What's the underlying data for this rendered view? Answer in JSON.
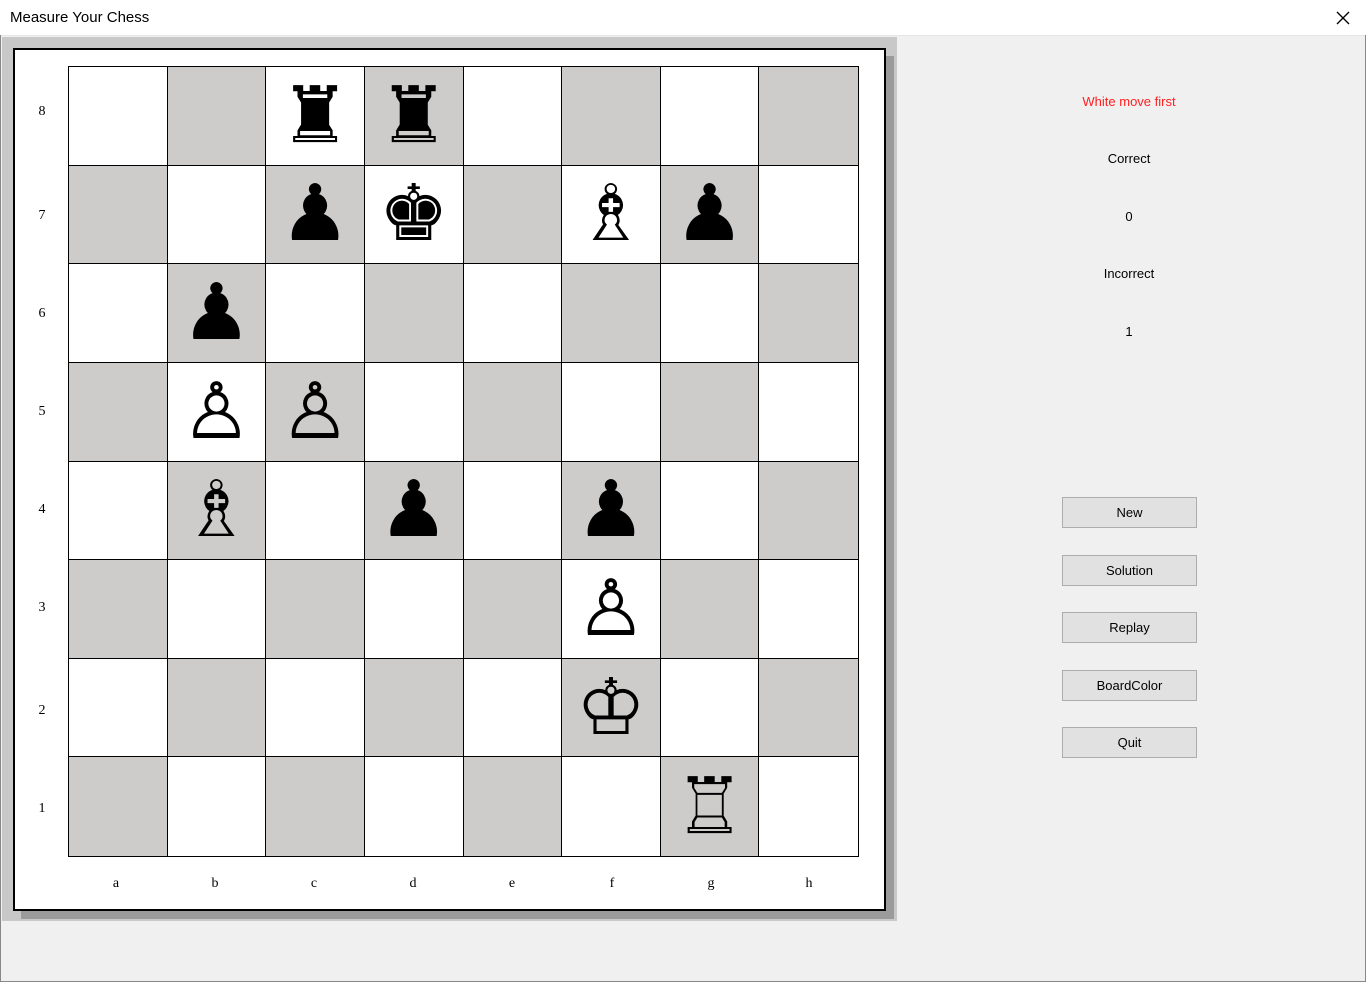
{
  "window": {
    "title": "Measure Your Chess"
  },
  "board": {
    "ranks": [
      "8",
      "7",
      "6",
      "5",
      "4",
      "3",
      "2",
      "1"
    ],
    "files": [
      "a",
      "b",
      "c",
      "d",
      "e",
      "f",
      "g",
      "h"
    ],
    "light_color": "#ffffff",
    "dark_color": "#cecbcb",
    "position": [
      [
        null,
        null,
        "♜",
        "♜",
        null,
        null,
        null,
        null
      ],
      [
        null,
        null,
        "♟",
        "♚",
        null,
        "♗",
        "♟",
        null
      ],
      [
        null,
        "♟",
        null,
        null,
        null,
        null,
        null,
        null
      ],
      [
        null,
        "♙",
        "♙",
        null,
        null,
        null,
        null,
        null
      ],
      [
        null,
        "♗",
        null,
        "♟",
        null,
        "♟",
        null,
        null
      ],
      [
        null,
        null,
        null,
        null,
        null,
        "♙",
        null,
        null
      ],
      [
        null,
        null,
        null,
        null,
        null,
        "♔",
        null,
        null
      ],
      [
        null,
        null,
        null,
        null,
        null,
        null,
        "♖",
        null
      ]
    ]
  },
  "panel": {
    "status": "White move first",
    "status_color": "#ff2020",
    "correct_label": "Correct",
    "correct_value": "0",
    "incorrect_label": "Incorrect",
    "incorrect_value": "1"
  },
  "buttons": {
    "new": "New",
    "solution": "Solution",
    "replay": "Replay",
    "boardcolor": "BoardColor",
    "quit": "Quit"
  }
}
